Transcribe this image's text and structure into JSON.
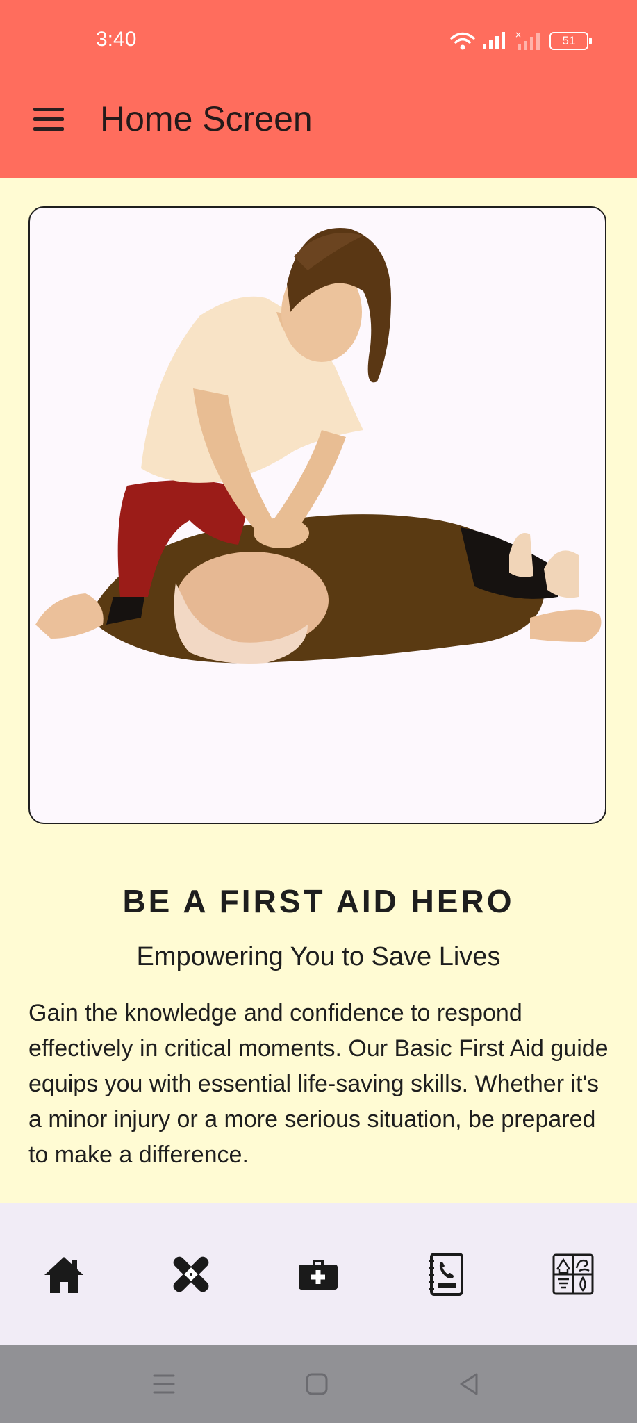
{
  "status_bar": {
    "time": "3:40",
    "battery": "51"
  },
  "app_bar": {
    "title": "Home Screen",
    "menu_icon": "hamburger-menu-icon"
  },
  "hero_image": {
    "icon": "cpr-illustration"
  },
  "content": {
    "headline": "BE A FIRST AID HERO",
    "subheadline": "Empowering You to Save Lives",
    "body": "Gain the knowledge and confidence to respond effectively in critical moments. Our Basic First Aid guide equips you with essential life-saving skills. Whether it's a minor injury or a more serious situation, be prepared to make a difference."
  },
  "bottom_nav": {
    "items": [
      {
        "icon": "home-icon"
      },
      {
        "icon": "bandage-icon"
      },
      {
        "icon": "first-aid-kit-icon"
      },
      {
        "icon": "phonebook-icon"
      },
      {
        "icon": "disaster-icon"
      }
    ]
  },
  "system_nav": {
    "buttons": [
      "recents",
      "home",
      "back"
    ]
  },
  "colors": {
    "header": "#ff6d5d",
    "background": "#fffbd3",
    "nav_bar": "#f1ecf6",
    "system_nav": "#919195"
  }
}
